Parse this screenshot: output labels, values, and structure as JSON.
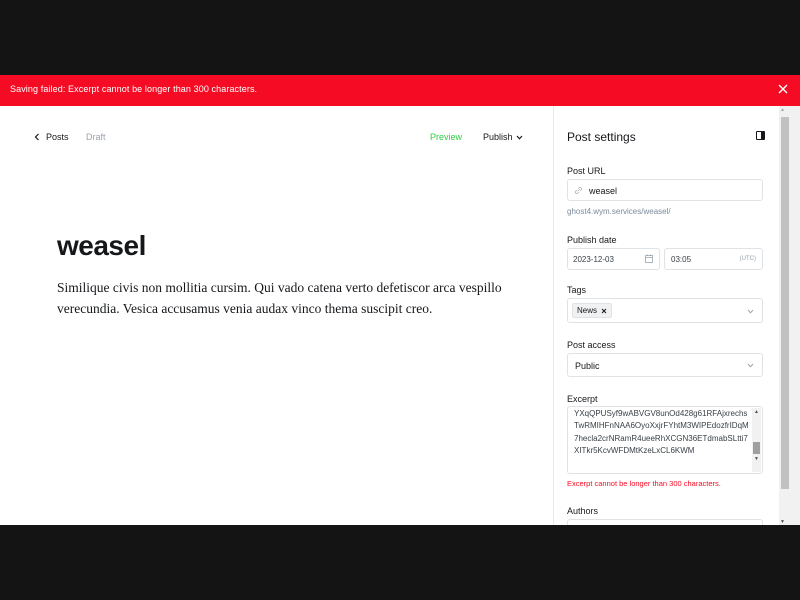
{
  "alert": {
    "message": "Saving failed: Excerpt cannot be longer than 300 characters."
  },
  "editor": {
    "back_label": "Posts",
    "status": "Draft",
    "preview_label": "Preview",
    "publish_label": "Publish",
    "title": "weasel",
    "body": "Similique civis non mollitia cursim. Qui vado catena verto defetiscor arca vespillo verecundia. Vesica accusamus venia audax vinco thema suscipit creo."
  },
  "settings": {
    "heading": "Post settings",
    "post_url_label": "Post URL",
    "post_url_value": "weasel",
    "post_url_hint": "ghost4.wym.services/weasel/",
    "publish_date_label": "Publish date",
    "date_value": "2023-12-03",
    "time_value": "03:05",
    "timezone": "(UTC)",
    "tags_label": "Tags",
    "tags": [
      "News"
    ],
    "access_label": "Post access",
    "access_value": "Public",
    "excerpt_label": "Excerpt",
    "excerpt_value": "YXqQPUSyf9wABVGV8unOd428g61RFAjxrechsTwRMIHFnNAA6OyoXxjrFYhtM3WIPEdozfrIDqM7hecla2crNRamR4ueeRhXCGN36ETdmabSLtti7XITkr5KcvWFDMtKzeLxCL6KWM",
    "excerpt_error": "Excerpt cannot be longer than 300 characters.",
    "authors_label": "Authors"
  },
  "colors": {
    "alert_bg": "#f50b23",
    "preview_green": "#30cf43",
    "error_red": "#f50b23"
  }
}
